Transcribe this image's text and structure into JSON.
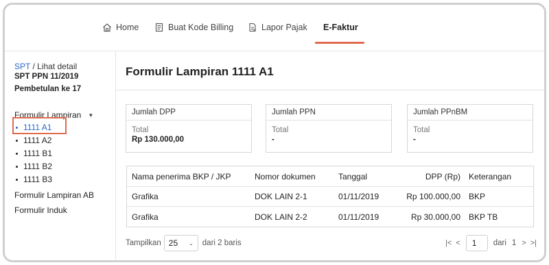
{
  "nav": {
    "items": [
      {
        "label": "Home",
        "icon": "home-icon"
      },
      {
        "label": "Buat Kode Billing",
        "icon": "billing-doc-icon"
      },
      {
        "label": "Lapor Pajak",
        "icon": "report-doc-icon"
      },
      {
        "label": "E-Faktur",
        "active": true
      }
    ],
    "accent": "#e06a4e"
  },
  "sidebar": {
    "crumb_link": "SPT",
    "crumb_rest": " / Lihat detail",
    "spt_title": "SPT PPN 11/2019",
    "spt_sub": "Pembetulan ke 17",
    "section": "Formulir Lampiran",
    "sub_items": [
      "1111 A1",
      "1111 A2",
      "1111 B1",
      "1111 B2",
      "1111 B3"
    ],
    "selected_index": 0,
    "links": [
      "Formulir Lampiran AB",
      "Formulir Induk"
    ],
    "link_color": "#2a67c9"
  },
  "main": {
    "title": "Formulir Lampiran 1111 A1",
    "cards": [
      {
        "head": "Jumlah DPP",
        "label": "Total",
        "value": "Rp 130.000,00"
      },
      {
        "head": "Jumlah PPN",
        "label": "Total",
        "value": "-"
      },
      {
        "head": "Jumlah PPnBM",
        "label": "Total",
        "value": "-"
      }
    ],
    "table": {
      "headers": [
        "Nama penerima BKP / JKP",
        "Nomor dokumen",
        "Tanggal",
        "DPP (Rp)",
        "Keterangan"
      ],
      "rows": [
        [
          "Grafika",
          "DOK LAIN 2-1",
          "01/11/2019",
          "Rp 100.000,00",
          "BKP"
        ],
        [
          "Grafika",
          "DOK LAIN 2-2",
          "01/11/2019",
          "Rp 30.000,00",
          "BKP TB"
        ]
      ]
    },
    "pager": {
      "show_label": "Tampilkan",
      "page_size": "25",
      "rows_text": "dari 2 baris",
      "first": "|<",
      "prev": "<",
      "page": "1",
      "of_label": "dari",
      "total_pages": "1",
      "next": ">",
      "last": ">|"
    }
  }
}
